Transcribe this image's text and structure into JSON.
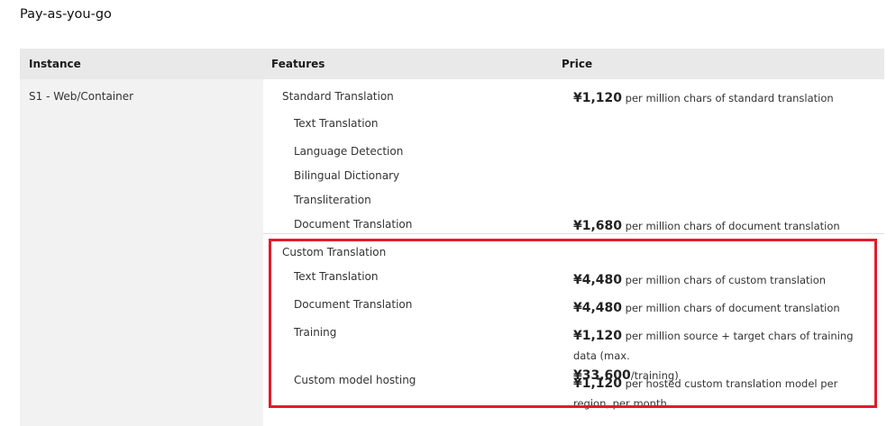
{
  "section_title": "Pay-as-you-go",
  "table": {
    "headers": [
      "Instance",
      "Features",
      "Price"
    ],
    "instance": "S1 - Web/Container",
    "features": {
      "standard_group": "Standard Translation",
      "standard_items": [
        "Text Translation",
        "Language Detection",
        "Bilingual Dictionary",
        "Transliteration",
        "Document Translation"
      ],
      "custom_group": "Custom Translation",
      "custom_items": [
        "Text Translation",
        "Document Translation",
        "Training",
        "Custom model hosting"
      ]
    },
    "prices": {
      "standard_text": {
        "amount": "¥1,120",
        "desc": " per million chars of standard translation"
      },
      "standard_document": {
        "amount": "¥1,680",
        "desc": " per million chars of document translation"
      },
      "custom_text": {
        "amount": "¥4,480",
        "desc": " per million chars of custom translation"
      },
      "custom_document": {
        "amount": "¥4,480",
        "desc": " per million chars of document translation"
      },
      "training": {
        "amount": "¥1,120",
        "desc": " per million source + target chars of training data (max.",
        "amount2": "¥33,600",
        "desc2": "/training)"
      },
      "hosting": {
        "amount": "¥1,120",
        "desc": " per hosted custom translation model per region, per month"
      }
    }
  },
  "highlight_color": "#e11b2a"
}
